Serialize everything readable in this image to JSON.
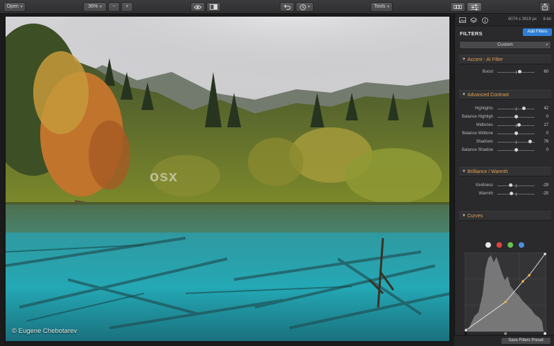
{
  "toolbar": {
    "open_label": "Open",
    "zoom_value": "36%",
    "zoom_out_label": "−",
    "zoom_in_label": "+",
    "tools_label": "Tools",
    "icons": [
      "eye-icon",
      "compare-icon",
      "undo-icon",
      "history-icon",
      "grid-view-icon",
      "sliders-icon",
      "share-icon"
    ]
  },
  "photo": {
    "watermark": "osx",
    "copyright": "© Eugene Chebotarev"
  },
  "panel": {
    "dimensions": "6074 x 3919 px",
    "bit_depth": "8-bit",
    "title": "FILTERS",
    "add_filters": "Add Filters",
    "preset": "Custom",
    "sections": [
      {
        "title": "Accent - AI Filter",
        "sliders": [
          {
            "label": "Boost",
            "value": "60",
            "level": 0.6
          }
        ]
      },
      {
        "title": "Advanced Contrast",
        "sliders": [
          {
            "label": "Highlights",
            "value": "42",
            "level": 0.71
          },
          {
            "label": "Balance Highligh",
            "value": "0",
            "level": 0.5
          },
          {
            "label": "Midtones",
            "value": "17",
            "level": 0.585
          },
          {
            "label": "Balance Midtone",
            "value": "0",
            "level": 0.5
          },
          {
            "label": "Shadows",
            "value": "76",
            "level": 0.88
          },
          {
            "label": "Balance Shadow",
            "value": "0",
            "level": 0.5
          }
        ]
      },
      {
        "title": "Brilliance / Warmth",
        "sliders": [
          {
            "label": "Vividness",
            "value": "-29",
            "level": 0.355
          },
          {
            "label": "Warmth",
            "value": "-25",
            "level": 0.375
          }
        ]
      },
      {
        "title": "Curves",
        "channels": [
          {
            "name": "rgb",
            "color": "#e8e8e8"
          },
          {
            "name": "red",
            "color": "#e0453f"
          },
          {
            "name": "green",
            "color": "#68c152"
          },
          {
            "name": "blue",
            "color": "#4b8fe3"
          }
        ],
        "curve_points": [
          [
            0,
            0
          ],
          [
            0.5,
            0.37
          ],
          [
            0.72,
            0.64
          ],
          [
            0.8,
            0.72
          ],
          [
            1,
            1
          ]
        ]
      }
    ],
    "save_preset": "Save Filters Preset"
  },
  "colors": {
    "accent": "#2f7fd5",
    "section_title": "#e2a04f"
  }
}
